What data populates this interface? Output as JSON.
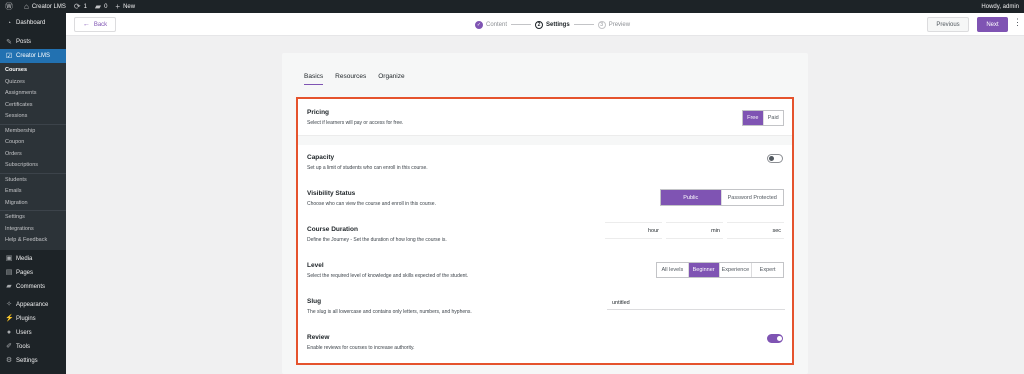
{
  "adminbar": {
    "wp_logo": "wordpress-icon",
    "site_name": "Creator LMS",
    "updates_count": "1",
    "comments_count": "0",
    "new_label": "New",
    "greeting": "Howdy, admin"
  },
  "sidebar": {
    "dashboard": "Dashboard",
    "posts": "Posts",
    "creator_lms": "Creator LMS",
    "sub": {
      "courses": "Courses",
      "quizzes": "Quizzes",
      "assignments": "Assignments",
      "certificates": "Certificates",
      "sessions": "Sessions",
      "membership": "Membership",
      "coupon": "Coupon",
      "orders": "Orders",
      "subscriptions": "Subscriptions",
      "students": "Students",
      "emails": "Emails",
      "migration": "Migration",
      "settings": "Settings",
      "integrations": "Integrations",
      "help": "Help & Feedback"
    },
    "media": "Media",
    "pages": "Pages",
    "comments": "Comments",
    "appearance": "Appearance",
    "plugins": "Plugins",
    "users": "Users",
    "tools": "Tools",
    "settings": "Settings"
  },
  "topbar": {
    "back": "Back",
    "steps": [
      {
        "num": "✓",
        "label": "Content"
      },
      {
        "num": "2",
        "label": "Settings"
      },
      {
        "num": "3",
        "label": "Preview"
      }
    ],
    "previous": "Previous",
    "next": "Next"
  },
  "tabs": [
    "Basics",
    "Resources",
    "Organize"
  ],
  "settings": {
    "pricing": {
      "title": "Pricing",
      "desc": "Select if learners will pay or access for free.",
      "options": [
        "Free",
        "Paid"
      ],
      "selected": "Free"
    },
    "capacity": {
      "title": "Capacity",
      "desc": "Set up a limit of students who can enroll in this course.",
      "enabled": false
    },
    "visibility": {
      "title": "Visibility Status",
      "desc": "Choose who can view the course and enroll in this course.",
      "options": [
        "Public",
        "Password Protected"
      ],
      "selected": "Public"
    },
    "duration": {
      "title": "Course Duration",
      "desc": "Define the Journey - Set the duration of how long the course is.",
      "units": [
        "hour",
        "min",
        "sec"
      ]
    },
    "level": {
      "title": "Level",
      "desc": "Select the required level of knowledge and skills expected of the student.",
      "options": [
        "All levels",
        "Beginner",
        "Experience",
        "Expert"
      ],
      "selected": "Beginner"
    },
    "slug": {
      "title": "Slug",
      "desc": "The slug is all lowercase and contains only letters, numbers, and hyphens.",
      "value": "untitled"
    },
    "review": {
      "title": "Review",
      "desc": "Enable reviews for courses to increase authority.",
      "enabled": true
    }
  }
}
